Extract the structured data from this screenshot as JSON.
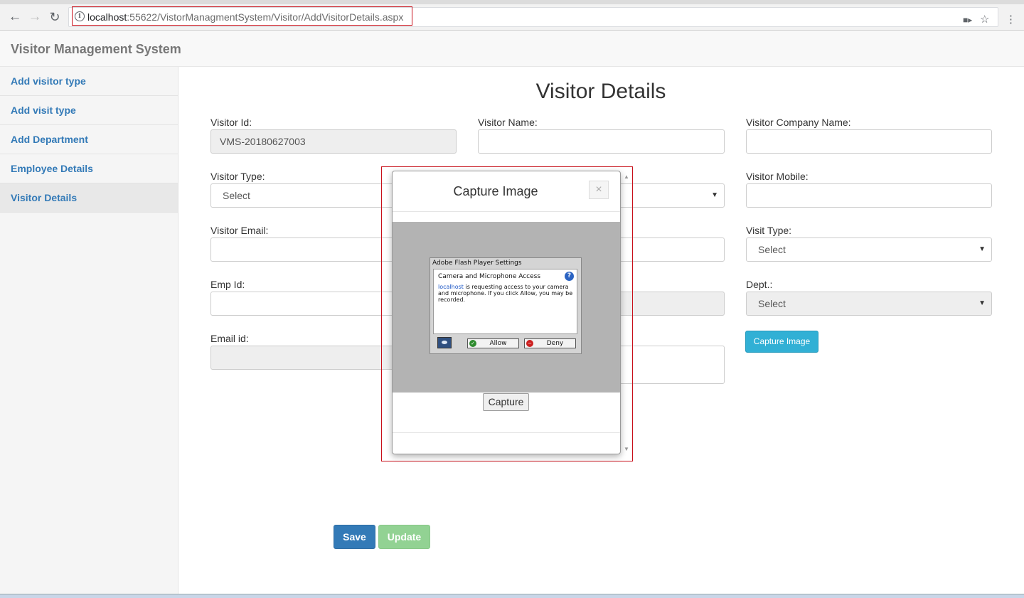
{
  "browser": {
    "url_host": "localhost",
    "url_rest": ":55622/VistorManagmentSystem/Visitor/AddVisitorDetails.aspx",
    "back_icon": "arrow-left-icon",
    "forward_icon": "arrow-right-icon",
    "reload_icon": "reload-icon",
    "info_icon": "info-icon",
    "camera_icon": "camera-icon",
    "star_icon": "star-icon",
    "menu_icon": "kebab-menu-icon"
  },
  "app": {
    "brand": "Visitor Management System"
  },
  "sidebar": {
    "items": [
      {
        "label": "Add visitor type"
      },
      {
        "label": "Add visit type"
      },
      {
        "label": "Add Department"
      },
      {
        "label": "Employee Details"
      },
      {
        "label": "Visitor Details",
        "active": true
      }
    ]
  },
  "form": {
    "title": "Visitor Details",
    "visitor_id_label": "Visitor Id:",
    "visitor_id_value": "VMS-20180627003",
    "visitor_name_label": "Visitor Name:",
    "visitor_company_label": "Visitor Company Name:",
    "visitor_type_label": "Visitor Type:",
    "visitor_type_value": "Select",
    "visitor_mobile_label": "Visitor Mobile:",
    "visitor_email_label": "Visitor Email:",
    "visit_type_label": "Visit Type:",
    "visit_type_value": "Select",
    "emp_id_label": "Emp Id:",
    "dept_label": "Dept.:",
    "dept_value": "Select",
    "email_id_label": "Email id:",
    "capture_image_button": "Capture Image",
    "save_button": "Save",
    "update_button": "Update"
  },
  "modal": {
    "title": "Capture Image",
    "close": "×",
    "capture_button": "Capture"
  },
  "flash": {
    "title": "Adobe Flash Player Settings",
    "heading": "Camera and Microphone Access",
    "help": "?",
    "host": "localhost",
    "message": " is requesting access to your camera and microphone. If you click Allow, you may be recorded.",
    "allow": "Allow",
    "deny": "Deny"
  },
  "colors": {
    "link_blue": "#337ab7",
    "primary": "#337ab7",
    "info": "#31b0d5",
    "success_disabled": "#92d293",
    "highlight_red": "#c8101a"
  }
}
